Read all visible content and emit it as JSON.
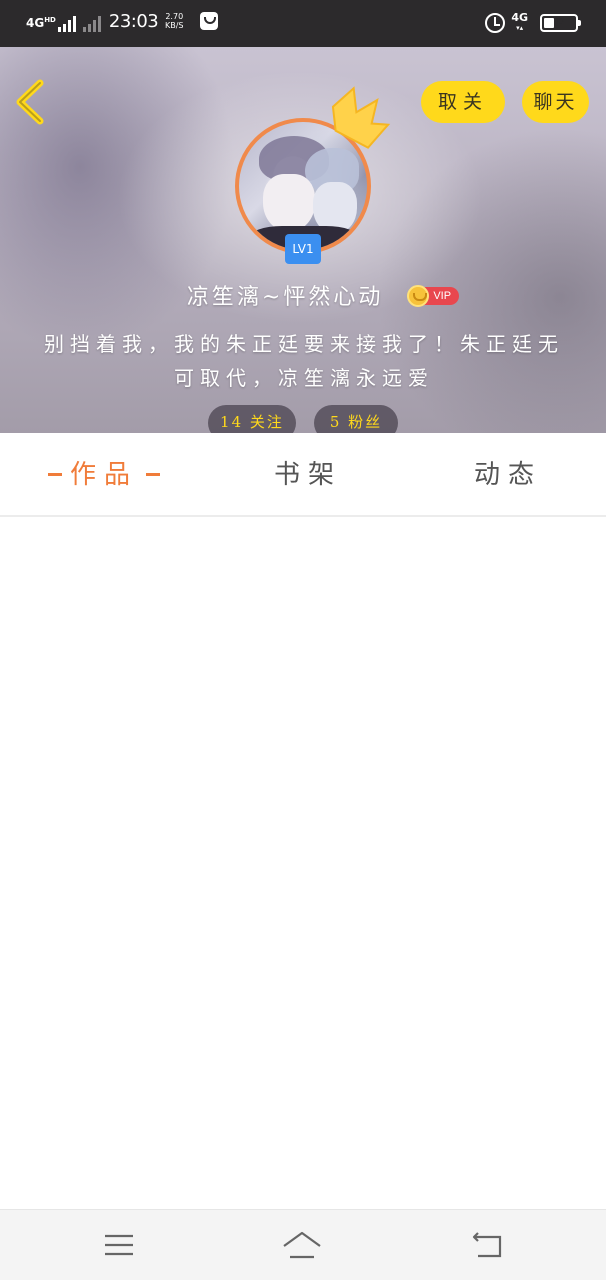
{
  "status_bar": {
    "network_left": "4G",
    "network_left_sup": "HD",
    "time": "23:03",
    "speed_value": "2.70",
    "speed_unit": "KB/S",
    "network_right": "4G",
    "battery_text": "33",
    "battery_level": 0.33,
    "icons": [
      "signal-icon",
      "shopping-bag-icon",
      "alarm-icon",
      "battery-icon"
    ]
  },
  "header": {
    "back_icon": "chevron-left-icon",
    "follow_button": "取关",
    "chat_button": "聊天",
    "accent_color": "#ffd91b",
    "level_badge": "LV1",
    "username": "凉笙漓~怦然心动",
    "vip_label": "VIP",
    "bio": "别挡着我，我的朱正廷要来接我了！朱正廷无可取代，凉笙漓永远爱",
    "follows_count": "14",
    "follows_label": "关注",
    "fans_count": "5",
    "fans_label": "粉丝"
  },
  "tabs": {
    "works": "作品",
    "shelf": "书架",
    "moments": "动态",
    "active": "作品",
    "active_color": "#f07c3a"
  },
  "navbar": {
    "icons": [
      "menu-icon",
      "home-icon",
      "back-icon"
    ]
  }
}
